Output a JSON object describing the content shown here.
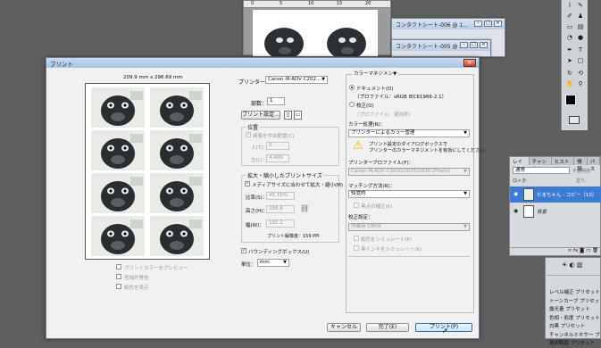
{
  "background_windows": {
    "contact_sheet_1": "コンタクトシート-006 @ 1...",
    "contact_sheet_2": "コンタクトシート-005 @ ...",
    "ruler_marks": [
      "0",
      "5",
      "10",
      "15",
      "20"
    ]
  },
  "layers_panel": {
    "tabs": [
      "レイヤー",
      "チャンネル",
      "ヒストリー",
      "情報",
      "パス"
    ],
    "blend_mode": "通常",
    "opacity_label": "不透明度:",
    "lock_label": "ロック:",
    "fill_label": "塗り:",
    "layers": [
      {
        "name": "たまちゃん - コピー（10）",
        "selected": true
      },
      {
        "name": "背景",
        "selected": false
      }
    ]
  },
  "adjustments_panel": {
    "items": [
      "レベル補正 プリセット",
      "トーンカーブ プリセット",
      "露光量 プリセット",
      "色相・彩度 プリセット",
      "白黒 プリセット",
      "チャンネルミキサー プリ…",
      "選択範囲 プリセット"
    ]
  },
  "dialog": {
    "title": "プリント",
    "paper_size": "209.9 mm x 296.69 mm",
    "printer_label": "プリンター：",
    "printer_value": "Canon iR-ADV C202...",
    "copies_label": "部数：",
    "copies_value": "1",
    "print_settings_button": "プリント設定...",
    "position": {
      "title": "位置",
      "center_label": "画像を中央配置(C)",
      "top_label": "上(T)：",
      "top_value": "0",
      "left_label": "左(L)：",
      "left_value": "4.409"
    },
    "scaled": {
      "title": "拡大・縮小したプリントサイズ",
      "fit_media_label": "メディアサイズに合わせて拡大・縮小(M)",
      "scale_label": "比率(S)：",
      "scale_value": "45.16%",
      "height_label": "高さ(H)：",
      "height_value": "286.8",
      "width_label": "幅(W)：",
      "width_value": "191.2",
      "resolution": "プリント解像度：159 PPI"
    },
    "bounding_box_label": "バウンディングボックス(U)",
    "units_label": "単位：",
    "units_value": "mm",
    "preview_options": [
      "プリントカラーをプレビュー",
      "色域外警告",
      "紙色を表示"
    ],
    "color_management": {
      "mode": "カラーマネジメント",
      "document_label": "ドキュメント(D)",
      "document_profile": "（プロファイル：sRGB IEC61966-2.1）",
      "proof_label": "校正(O)",
      "proof_profile": "（プロファイル：適用外）",
      "color_handling_label": "カラー処理(N)：",
      "color_handling_value": "プリンターによるカラー管理",
      "warning_line1": "プリント設定のダイアログボックスで",
      "warning_line2": "プリンターのカラーマネジメントを有効にしてください。",
      "printer_profile_label": "プリンタープロファイル(F)：",
      "printer_profile_value": "Canon iR-ADV C2020/2025/2030 (Photo)",
      "rendering_intent_label": "マッチング方法(R)：",
      "rendering_intent_value": "知覚的",
      "bpc_label": "黒点の補正(K)",
      "proof_setup_label": "校正設定：",
      "proof_setup_value": "作業用 CMYK",
      "simulate_paper": "紙色をシミュレート(P)",
      "simulate_black": "黒インキをシミュレート(K)"
    },
    "buttons": {
      "cancel": "キャンセル",
      "done": "完了(E)",
      "print": "プリント(P)"
    }
  },
  "colors": {
    "accent": "#3a6fb7",
    "selected_layer": "#3b7bd4",
    "dialog_title": "#b6cbe6"
  }
}
